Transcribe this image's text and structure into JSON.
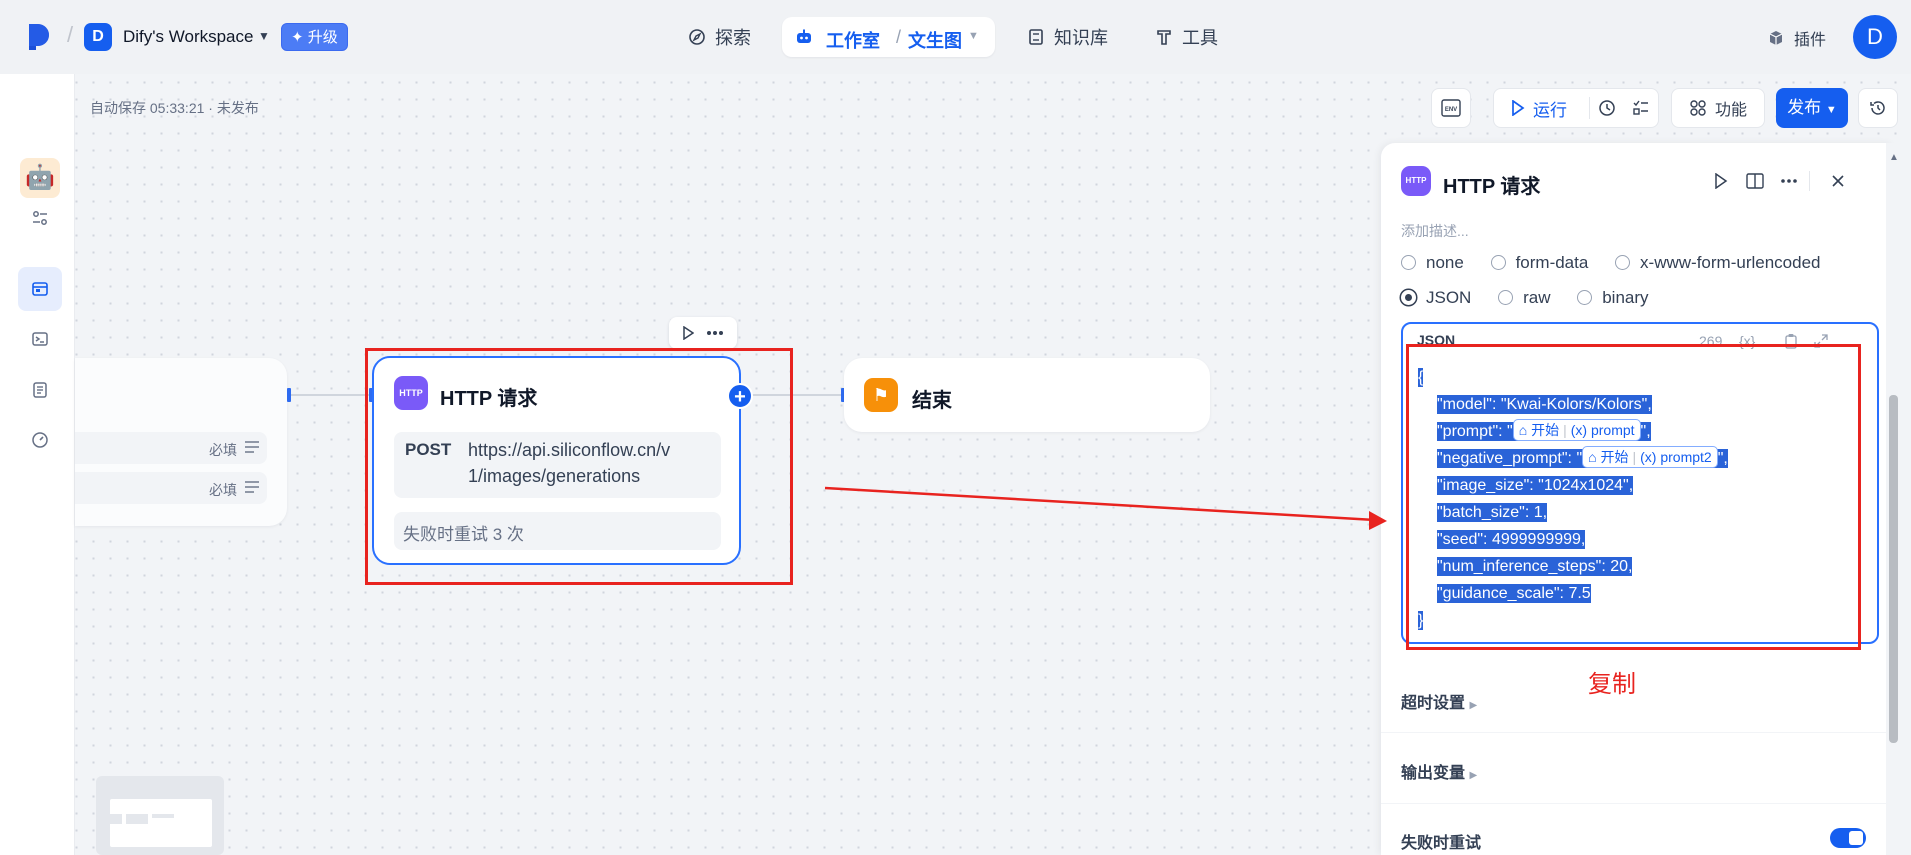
{
  "topbar": {
    "workspace_initial": "D",
    "workspace_name": "Dify's Workspace",
    "upgrade_label": "升级",
    "nav": {
      "explore": "探索",
      "studio": "工作室",
      "app": "文生图",
      "knowledge": "知识库",
      "tools": "工具"
    },
    "plugins": "插件",
    "user_initial": "D"
  },
  "canvas": {
    "autosave": "自动保存 05:33:21 · 未发布",
    "toolbar": {
      "env": "ENV",
      "run": "运行",
      "features": "功能",
      "publish": "发布"
    },
    "start_node": {
      "rows": [
        {
          "required": "必填"
        },
        {
          "required": "必填"
        }
      ]
    },
    "http_node": {
      "badge": "HTTP",
      "title": "HTTP 请求",
      "method": "POST",
      "url_line1": "https://api.siliconflow.cn/v",
      "url_line2": "1/images/generations",
      "retry": "失败时重试 3 次"
    },
    "end_node": {
      "title": "结束"
    }
  },
  "panel": {
    "badge": "HTTP",
    "title": "HTTP 请求",
    "description_placeholder": "添加描述...",
    "body_types_row1": [
      "none",
      "form-data",
      "x-www-form-urlencoded"
    ],
    "body_types_row2": [
      "JSON",
      "raw",
      "binary"
    ],
    "selected_body_type": "JSON",
    "json_editor": {
      "label": "JSON",
      "char_count": "269",
      "lines": {
        "open": "{",
        "model": "\"model\": \"Kwai-Kolors/Kolors\",",
        "prompt_prefix": "\"prompt\": \"",
        "prompt_suffix": "\",",
        "negative_prefix": "\"negative_prompt\": \"",
        "negative_suffix": "\",",
        "image_size": "\"image_size\": \"1024x1024\",",
        "batch_size": "\"batch_size\": 1,",
        "seed": "\"seed\": 4999999999,",
        "steps": "\"num_inference_steps\": 20,",
        "guidance": "\"guidance_scale\": 7.5",
        "close": "}"
      },
      "chip1": {
        "node": "开始",
        "var": "prompt"
      },
      "chip2": {
        "node": "开始",
        "var": "prompt2"
      }
    },
    "timeout_settings": "超时设置",
    "output_vars": "输出变量",
    "retry_on_failure": "失败时重试",
    "retry_enabled": true
  },
  "annotation": {
    "label": "复制",
    "color": "#e8231f"
  }
}
